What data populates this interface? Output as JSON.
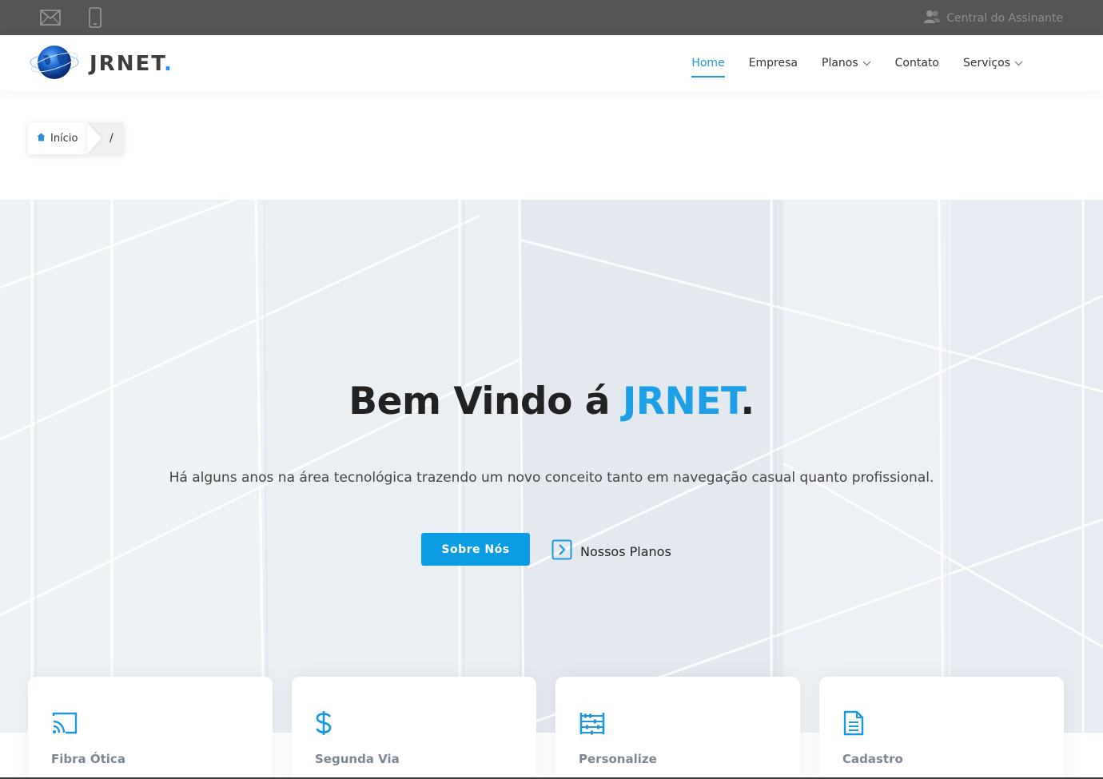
{
  "topbar": {
    "icons": [
      "envelope-icon",
      "mobile-phone-icon"
    ],
    "central_label": "Central do Assinante"
  },
  "header": {
    "logo_text": "JRNET",
    "logo_dot": ".",
    "nav": [
      {
        "label": "Home",
        "active": true
      },
      {
        "label": "Empresa"
      },
      {
        "label": "Planos",
        "dropdown": true
      },
      {
        "label": "Contato"
      },
      {
        "label": "Serviços",
        "dropdown": true
      }
    ]
  },
  "breadcrumb": {
    "home_label": "Início",
    "separator": "/"
  },
  "hero": {
    "title_prefix": "Bem Vindo á ",
    "title_brand": "JRNET",
    "title_suffix": ".",
    "subtitle": "Há alguns anos na área tecnológica trazendo um novo conceito tanto em navegação casual quanto profissional.",
    "primary_button": "Sobre Nós",
    "secondary_link": "Nossos Planos"
  },
  "features": [
    {
      "title": "Fibra Ótica",
      "icon": "cast-icon"
    },
    {
      "title": "Segunda Via",
      "icon": "dollar-icon"
    },
    {
      "title": "Personalize",
      "icon": "abacus-icon"
    },
    {
      "title": "Cadastro",
      "icon": "document-icon"
    }
  ],
  "colors": {
    "accent": "#1a98e0",
    "button": "#0b9ce4",
    "topbar": "#555555"
  }
}
